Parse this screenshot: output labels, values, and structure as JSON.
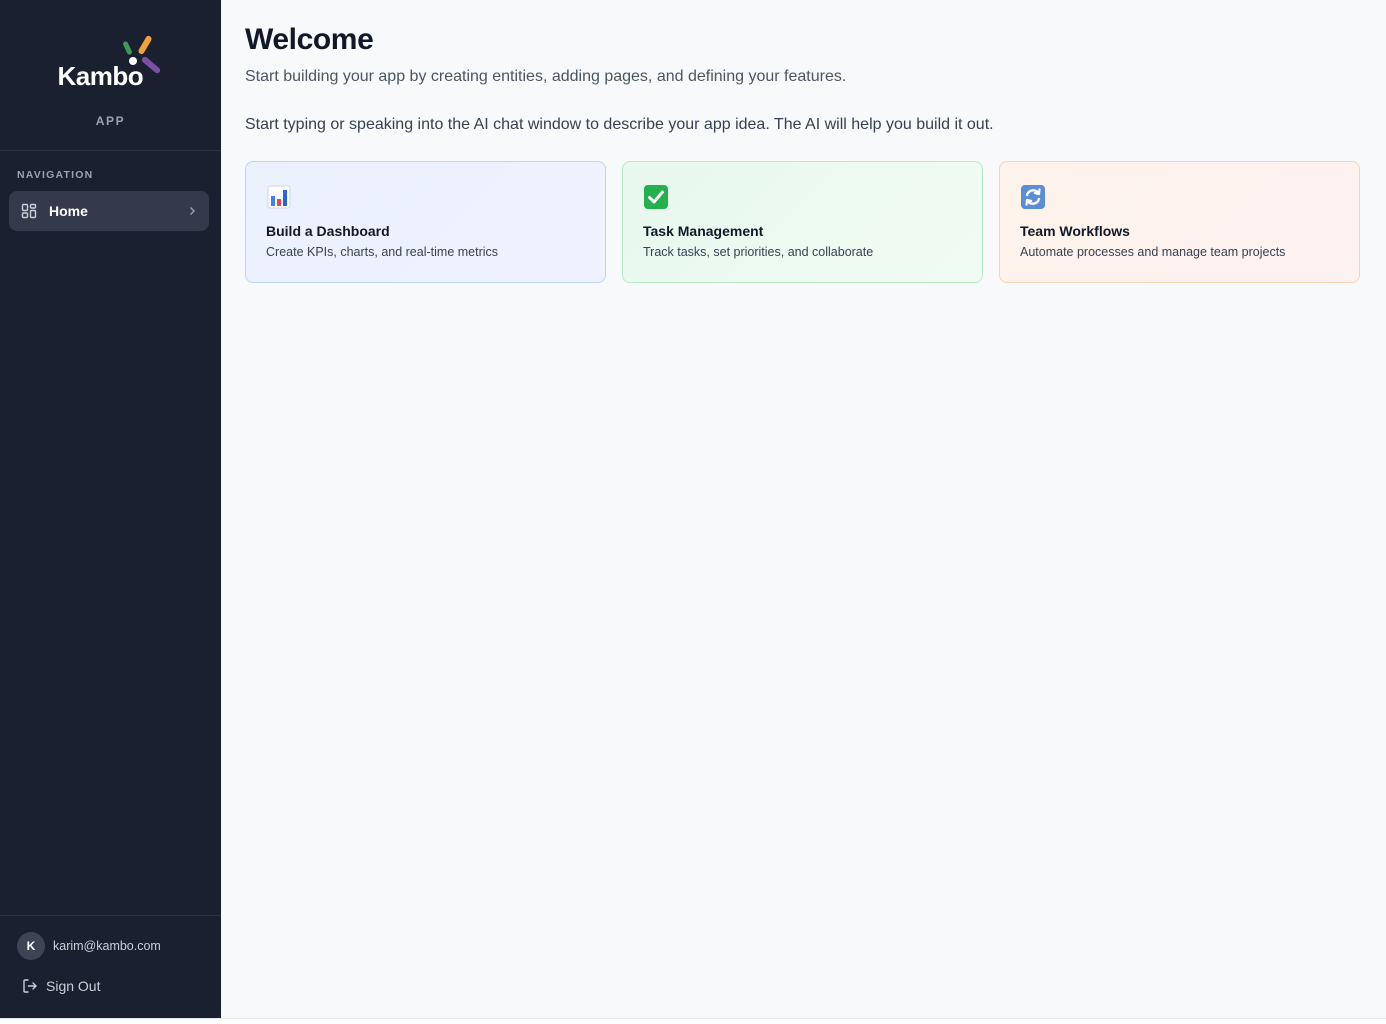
{
  "sidebar": {
    "brand": {
      "name": "Kambo",
      "app_label": "APP"
    },
    "nav_section_label": "NAVIGATION",
    "nav_items": [
      {
        "label": "Home",
        "icon": "dashboard-grid-icon",
        "active": true
      }
    ],
    "user": {
      "initial": "K",
      "email": "karim@kambo.com"
    },
    "sign_out_label": "Sign Out"
  },
  "main": {
    "title": "Welcome",
    "subtitle": "Start building your app by creating entities, adding pages, and defining your features.",
    "hint": "Start typing or speaking into the AI chat window to describe your app idea. The AI will help you build it out.",
    "cards": [
      {
        "title": "Build a Dashboard",
        "description": "Create KPIs, charts, and real-time metrics",
        "icon": "bar-chart-icon",
        "accent": "#bfd3f3"
      },
      {
        "title": "Task Management",
        "description": "Track tasks, set priorities, and collaborate",
        "icon": "check-mark-icon",
        "accent": "#b7ebc8"
      },
      {
        "title": "Team Workflows",
        "description": "Automate processes and manage team projects",
        "icon": "refresh-icon",
        "accent": "#f6d4b4"
      }
    ]
  },
  "colors": {
    "sidebar_bg": "#1b2030",
    "main_bg": "#f8f9fb",
    "logo_green": "#3d9a5a",
    "logo_orange": "#f2a23a",
    "logo_purple": "#7b4fa3"
  }
}
